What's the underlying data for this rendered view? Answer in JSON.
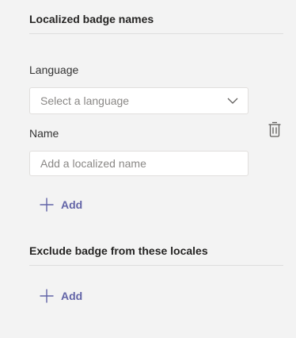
{
  "localized": {
    "title": "Localized badge names",
    "language_label": "Language",
    "language_placeholder": "Select a language",
    "name_label": "Name",
    "name_placeholder": "Add a localized name",
    "add_label": "Add"
  },
  "exclude": {
    "title": "Exclude badge from these locales",
    "add_label": "Add"
  },
  "colors": {
    "accent": "#6264a7",
    "background": "#f3f3f3",
    "text": "#252423",
    "placeholder": "#8a8886"
  },
  "icons": {
    "dropdown": "chevron-down-icon",
    "delete": "trash-icon",
    "add": "plus-icon"
  }
}
